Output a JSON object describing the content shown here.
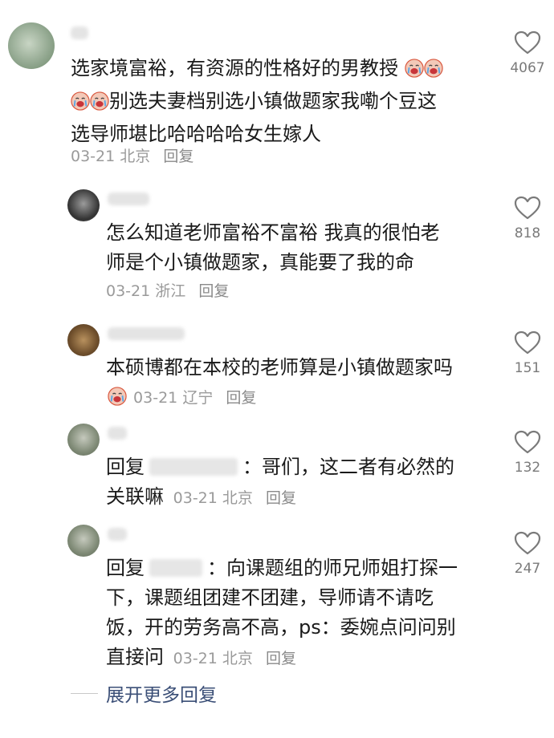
{
  "comments": [
    {
      "user": "",
      "text_lines": [
        "选家境富裕，有资源的性格好的男教授",
        "别选夫妻档别选小镇做题家我嘞个豆这",
        "选导师堪比哈哈哈哈女生嫁人"
      ],
      "date": "03-21",
      "location": "北京",
      "reply_label": "回复",
      "likes": "4067"
    },
    {
      "user": "",
      "text_lines": [
        "怎么知道老师富裕不富裕 我真的很怕老",
        "师是个小镇做题家，真能要了我的命"
      ],
      "date": "03-21",
      "location": "浙江",
      "reply_label": "回复",
      "likes": "818"
    },
    {
      "user": "",
      "text_lines": [
        "本硕博都在本校的老师算是小镇做题家吗"
      ],
      "date": "03-21",
      "location": "辽宁",
      "reply_label": "回复",
      "likes": "151"
    },
    {
      "user": "",
      "reply_prefix": "回复",
      "text_lines": [
        "：哥们，这二者有必然的",
        "关联嘛"
      ],
      "date": "03-21",
      "location": "北京",
      "reply_label": "回复",
      "likes": "132"
    },
    {
      "user": "",
      "reply_prefix": "回复",
      "text_lines": [
        "：向课题组的师兄师姐打探一",
        "下，课题组团建不团建，导师请不请吃",
        "饭，开的劳务高不高，ps：委婉点问问别",
        "直接问"
      ],
      "date": "03-21",
      "location": "北京",
      "reply_label": "回复",
      "likes": "247"
    }
  ],
  "expand_label": "展开更多回复",
  "colors": {
    "text": "#1a1a1a",
    "meta": "#9a9a9a",
    "link": "#3b4f77"
  }
}
